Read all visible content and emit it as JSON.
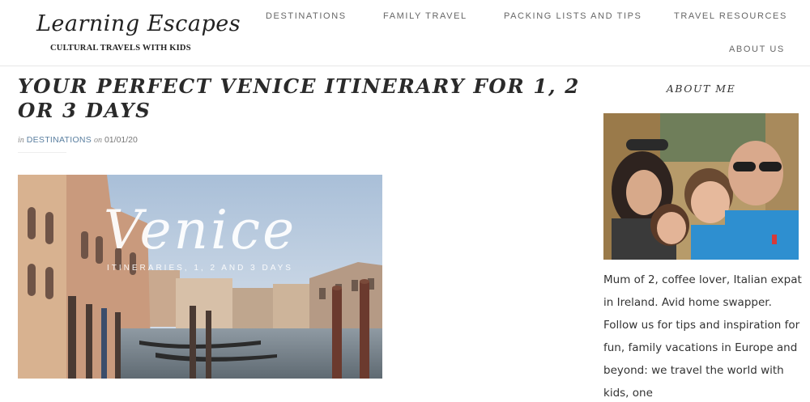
{
  "site": {
    "logo_script": "Learning Escapes",
    "tagline": "CULTURAL TRAVELS WITH KIDS"
  },
  "nav": {
    "items": [
      {
        "label": "DESTINATIONS"
      },
      {
        "label": "FAMILY TRAVEL"
      },
      {
        "label": "PACKING LISTS AND TIPS"
      },
      {
        "label": "TRAVEL RESOURCES"
      },
      {
        "label": "ABOUT US"
      }
    ]
  },
  "post": {
    "title": "YOUR PERFECT VENICE ITINERARY FOR 1, 2 OR 3 DAYS",
    "meta_in": "in",
    "meta_category": "DESTINATIONS",
    "meta_on": "on",
    "meta_date": "01/01/20",
    "hero_title": "Venice",
    "hero_subtitle": "ITINERARIES, 1, 2 AND 3 DAYS"
  },
  "sidebar": {
    "heading": "ABOUT ME",
    "bio": "Mum of 2, coffee lover, Italian expat in Ireland. Avid home swapper. Follow us for tips and inspiration for fun, family vacations in Europe and beyond: we travel the world with kids, one"
  },
  "colors": {
    "link": "#5a7fa0",
    "nav_text": "#666666",
    "title_text": "#2a2a2a"
  }
}
